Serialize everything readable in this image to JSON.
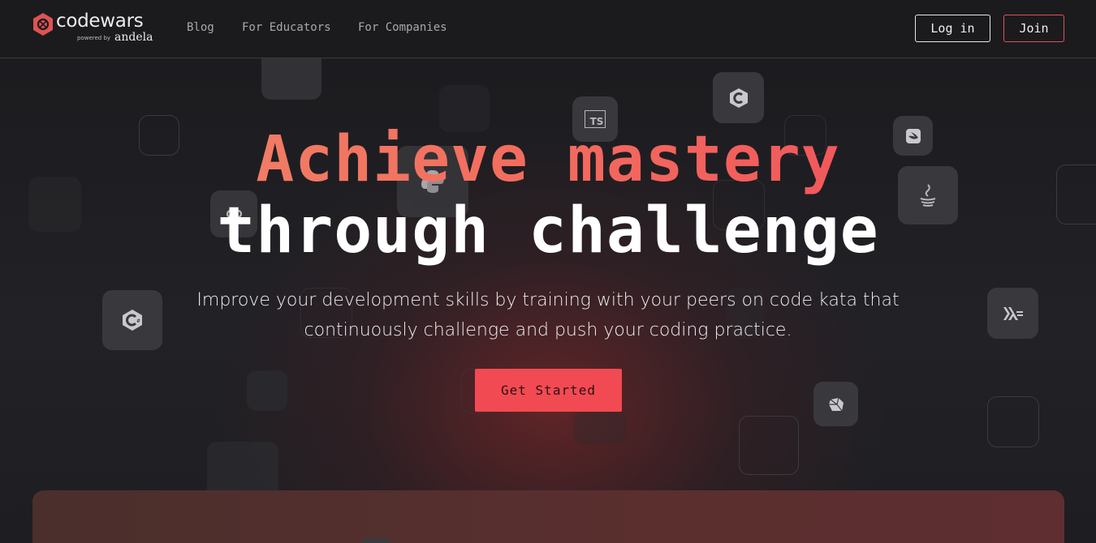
{
  "brand": {
    "name": "codewars",
    "powered_by": "powered by",
    "partner": "andela",
    "color": "#e05252"
  },
  "nav": {
    "links": [
      {
        "label": "Blog"
      },
      {
        "label": "For Educators"
      },
      {
        "label": "For Companies"
      }
    ],
    "login_label": "Log in",
    "join_label": "Join"
  },
  "hero": {
    "headline_1": "Achieve mastery",
    "headline_2": "through challenge",
    "subtitle": "Improve your development skills by training with your peers on code kata that continuously challenge and push your coding practice.",
    "cta_label": "Get Started"
  },
  "tiles": {
    "typescript": "TS",
    "csharp": "C#",
    "c": "C",
    "swift": "swift-icon",
    "java": "java-icon",
    "haskell": "haskell-icon",
    "python": "python-icon",
    "ruby": "ruby-icon",
    "go": "go-icon"
  },
  "colors": {
    "accent": "#f24a52",
    "background": "#1e1e22",
    "gradient_start": "#f08a6a",
    "gradient_end": "#f0485a"
  }
}
